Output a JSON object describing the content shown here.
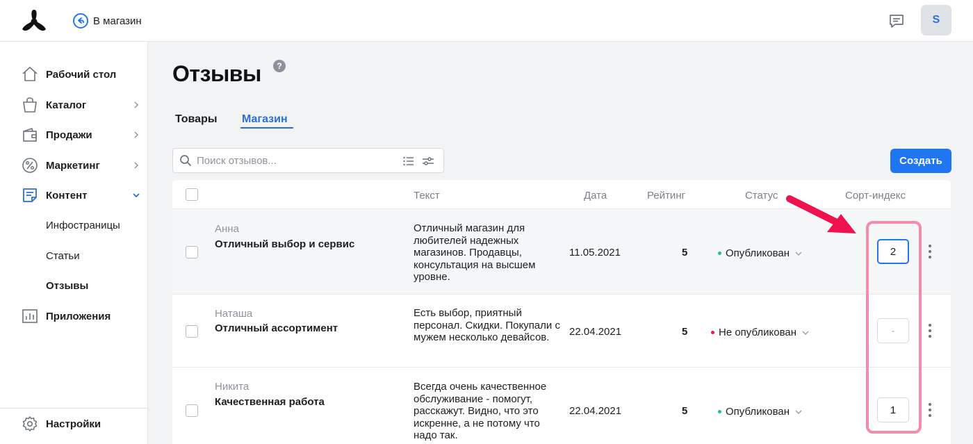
{
  "topbar": {
    "back_label": "В магазин",
    "avatar_initial": "S"
  },
  "sidebar": {
    "items": [
      {
        "label": "Рабочий стол",
        "icon": "home-icon"
      },
      {
        "label": "Каталог",
        "icon": "bag-icon"
      },
      {
        "label": "Продажи",
        "icon": "wallet-icon"
      },
      {
        "label": "Маркетинг",
        "icon": "percent-icon"
      },
      {
        "label": "Контент",
        "icon": "document-icon"
      },
      {
        "label": "Приложения",
        "icon": "apps-chart-icon"
      }
    ],
    "content_subitems": [
      "Инфостраницы",
      "Статьи",
      "Отзывы"
    ],
    "settings_label": "Настройки"
  },
  "page": {
    "title": "Отзывы",
    "help": "?",
    "tabs": [
      "Товары",
      "Магазин"
    ],
    "active_tab": "Магазин"
  },
  "search": {
    "placeholder": "Поиск отзывов..."
  },
  "toolbar": {
    "create_label": "Создать"
  },
  "table": {
    "columns": [
      "Текст",
      "Дата",
      "Рейтинг",
      "Статус",
      "Сорт-индекс"
    ],
    "rows": [
      {
        "author": "Анна",
        "title": "Отличный выбор и сервис",
        "text": "Отличный магазин для любителей надежных магазинов. Продавцы, консультация на высшем уровне.",
        "date": "11.05.2021",
        "rating": "5",
        "status": "Опубликован",
        "status_color": "#23c08a",
        "sort_index": "2",
        "sort_placeholder": ""
      },
      {
        "author": "Наташа",
        "title": "Отличный ассортимент",
        "text": "Есть выбор, приятный персонал. Скидки. Покупали с мужем несколько девайсов.",
        "date": "22.04.2021",
        "rating": "5",
        "status": "Не опубликован",
        "status_color": "#e8194d",
        "sort_index": "",
        "sort_placeholder": "-"
      },
      {
        "author": "Никита",
        "title": "Качественная работа",
        "text": "Всегда очень качественное обслуживание - помогут, расскажут. Видно, что это искренне, а не потому что надо так.",
        "date": "22.04.2021",
        "rating": "5",
        "status": "Опубликован",
        "status_color": "#23c08a",
        "sort_index": "1",
        "sort_placeholder": ""
      }
    ]
  },
  "colors": {
    "accent": "#1f76f0",
    "annotation_box": "#f28ca8",
    "annotation_arrow": "#f0124e"
  }
}
